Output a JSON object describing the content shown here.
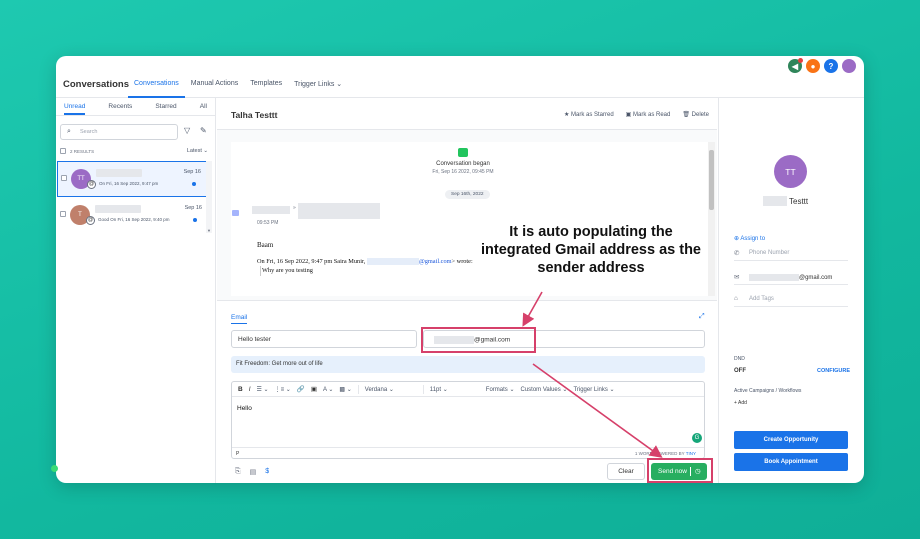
{
  "app": {
    "title": "Conversations"
  },
  "topnav": [
    {
      "label": "Conversations",
      "active": true
    },
    {
      "label": "Manual Actions",
      "active": false
    },
    {
      "label": "Templates",
      "active": false
    },
    {
      "label": "Trigger Links ⌄",
      "active": false
    }
  ],
  "top_icons": [
    {
      "name": "megaphone-icon",
      "glyph": "◀",
      "color": "#2f855a"
    },
    {
      "name": "bell-icon",
      "glyph": "🔔",
      "color": "#f97316"
    },
    {
      "name": "help-icon",
      "glyph": "?",
      "color": "#1a73e8"
    },
    {
      "name": "profile-avatar",
      "glyph": "",
      "color": "#9b6bc5"
    }
  ],
  "left": {
    "tabs": [
      "Unread",
      "Recents",
      "Starred",
      "All"
    ],
    "search_placeholder": "Search",
    "results": "2 RESULTS",
    "sort": "Latest ⌄",
    "conversations": [
      {
        "initials": "TT",
        "color": "#9b6bc5",
        "date": "Sep 16",
        "snippet": "On Fri, 16 Sep 2022, 9:47 pm"
      },
      {
        "initials": "T",
        "color": "#c0806b",
        "date": "Sep 16",
        "snippet": "Good On Fri, 16 Sep 2022, 9:40 pm"
      }
    ]
  },
  "middle": {
    "contact_name": "Talha Testtt",
    "actions": [
      "★ Mark as Starred",
      "▣ Mark as Read",
      "🗑 Delete"
    ],
    "conversation_began": "Conversation began",
    "conversation_began_date": "Fri, Sep 16 2022, 09:45 PM",
    "date_pill": "Sep 16th, 2022",
    "msg_separator": "»",
    "msg_time": "09:53 PM",
    "msg_body": "Baam",
    "quote_prefix": "On Fri, 16 Sep 2022, 9:47 pm Saira Munir, ",
    "quote_link": "@gmail.com",
    "quote_suffix": "> wrote:",
    "quote_line": "Why are you testing"
  },
  "compose": {
    "tab": "Email",
    "to_value": "Hello tester",
    "from_value": "@gmail.com",
    "template": "Fit Freedom: Get more out of life",
    "toolbar": [
      "B",
      "I",
      "☰ ⌄",
      "⋮≡ ⌄",
      "🔗",
      "▣",
      "A ⌄",
      "▩ ⌄"
    ],
    "font": "Verdana ⌄",
    "size": "11pt ⌄",
    "formats": "Formats ⌄",
    "custom_values": "Custom Values ⌄",
    "trigger_links": "Trigger Links ⌄",
    "body": "Hello",
    "p_mark": "P",
    "powered": "1 WORD POWERED BY",
    "powered_brand": "TINY",
    "clear": "Clear",
    "send": "Send now",
    "bottom_icons": [
      "paperclip-icon",
      "document-icon",
      "dollar-icon"
    ]
  },
  "right": {
    "initials": "TT",
    "name_suffix": "Testtt",
    "assign": "⊕ Assign to",
    "phone_placeholder": "Phone Number",
    "email_value": "@gmail.com",
    "tags_placeholder": "Add Tags",
    "dnd_label": "DND",
    "dnd_value": "OFF",
    "configure": "CONFIGURE",
    "campaigns": "Active Campaigns / Workflows",
    "add": "+ Add",
    "create_opportunity": "Create Opportunity",
    "book_appointment": "Book Appointment"
  },
  "annotation": {
    "text": "It is auto populating the integrated Gmail address as the sender address",
    "color": "#d6406a"
  }
}
